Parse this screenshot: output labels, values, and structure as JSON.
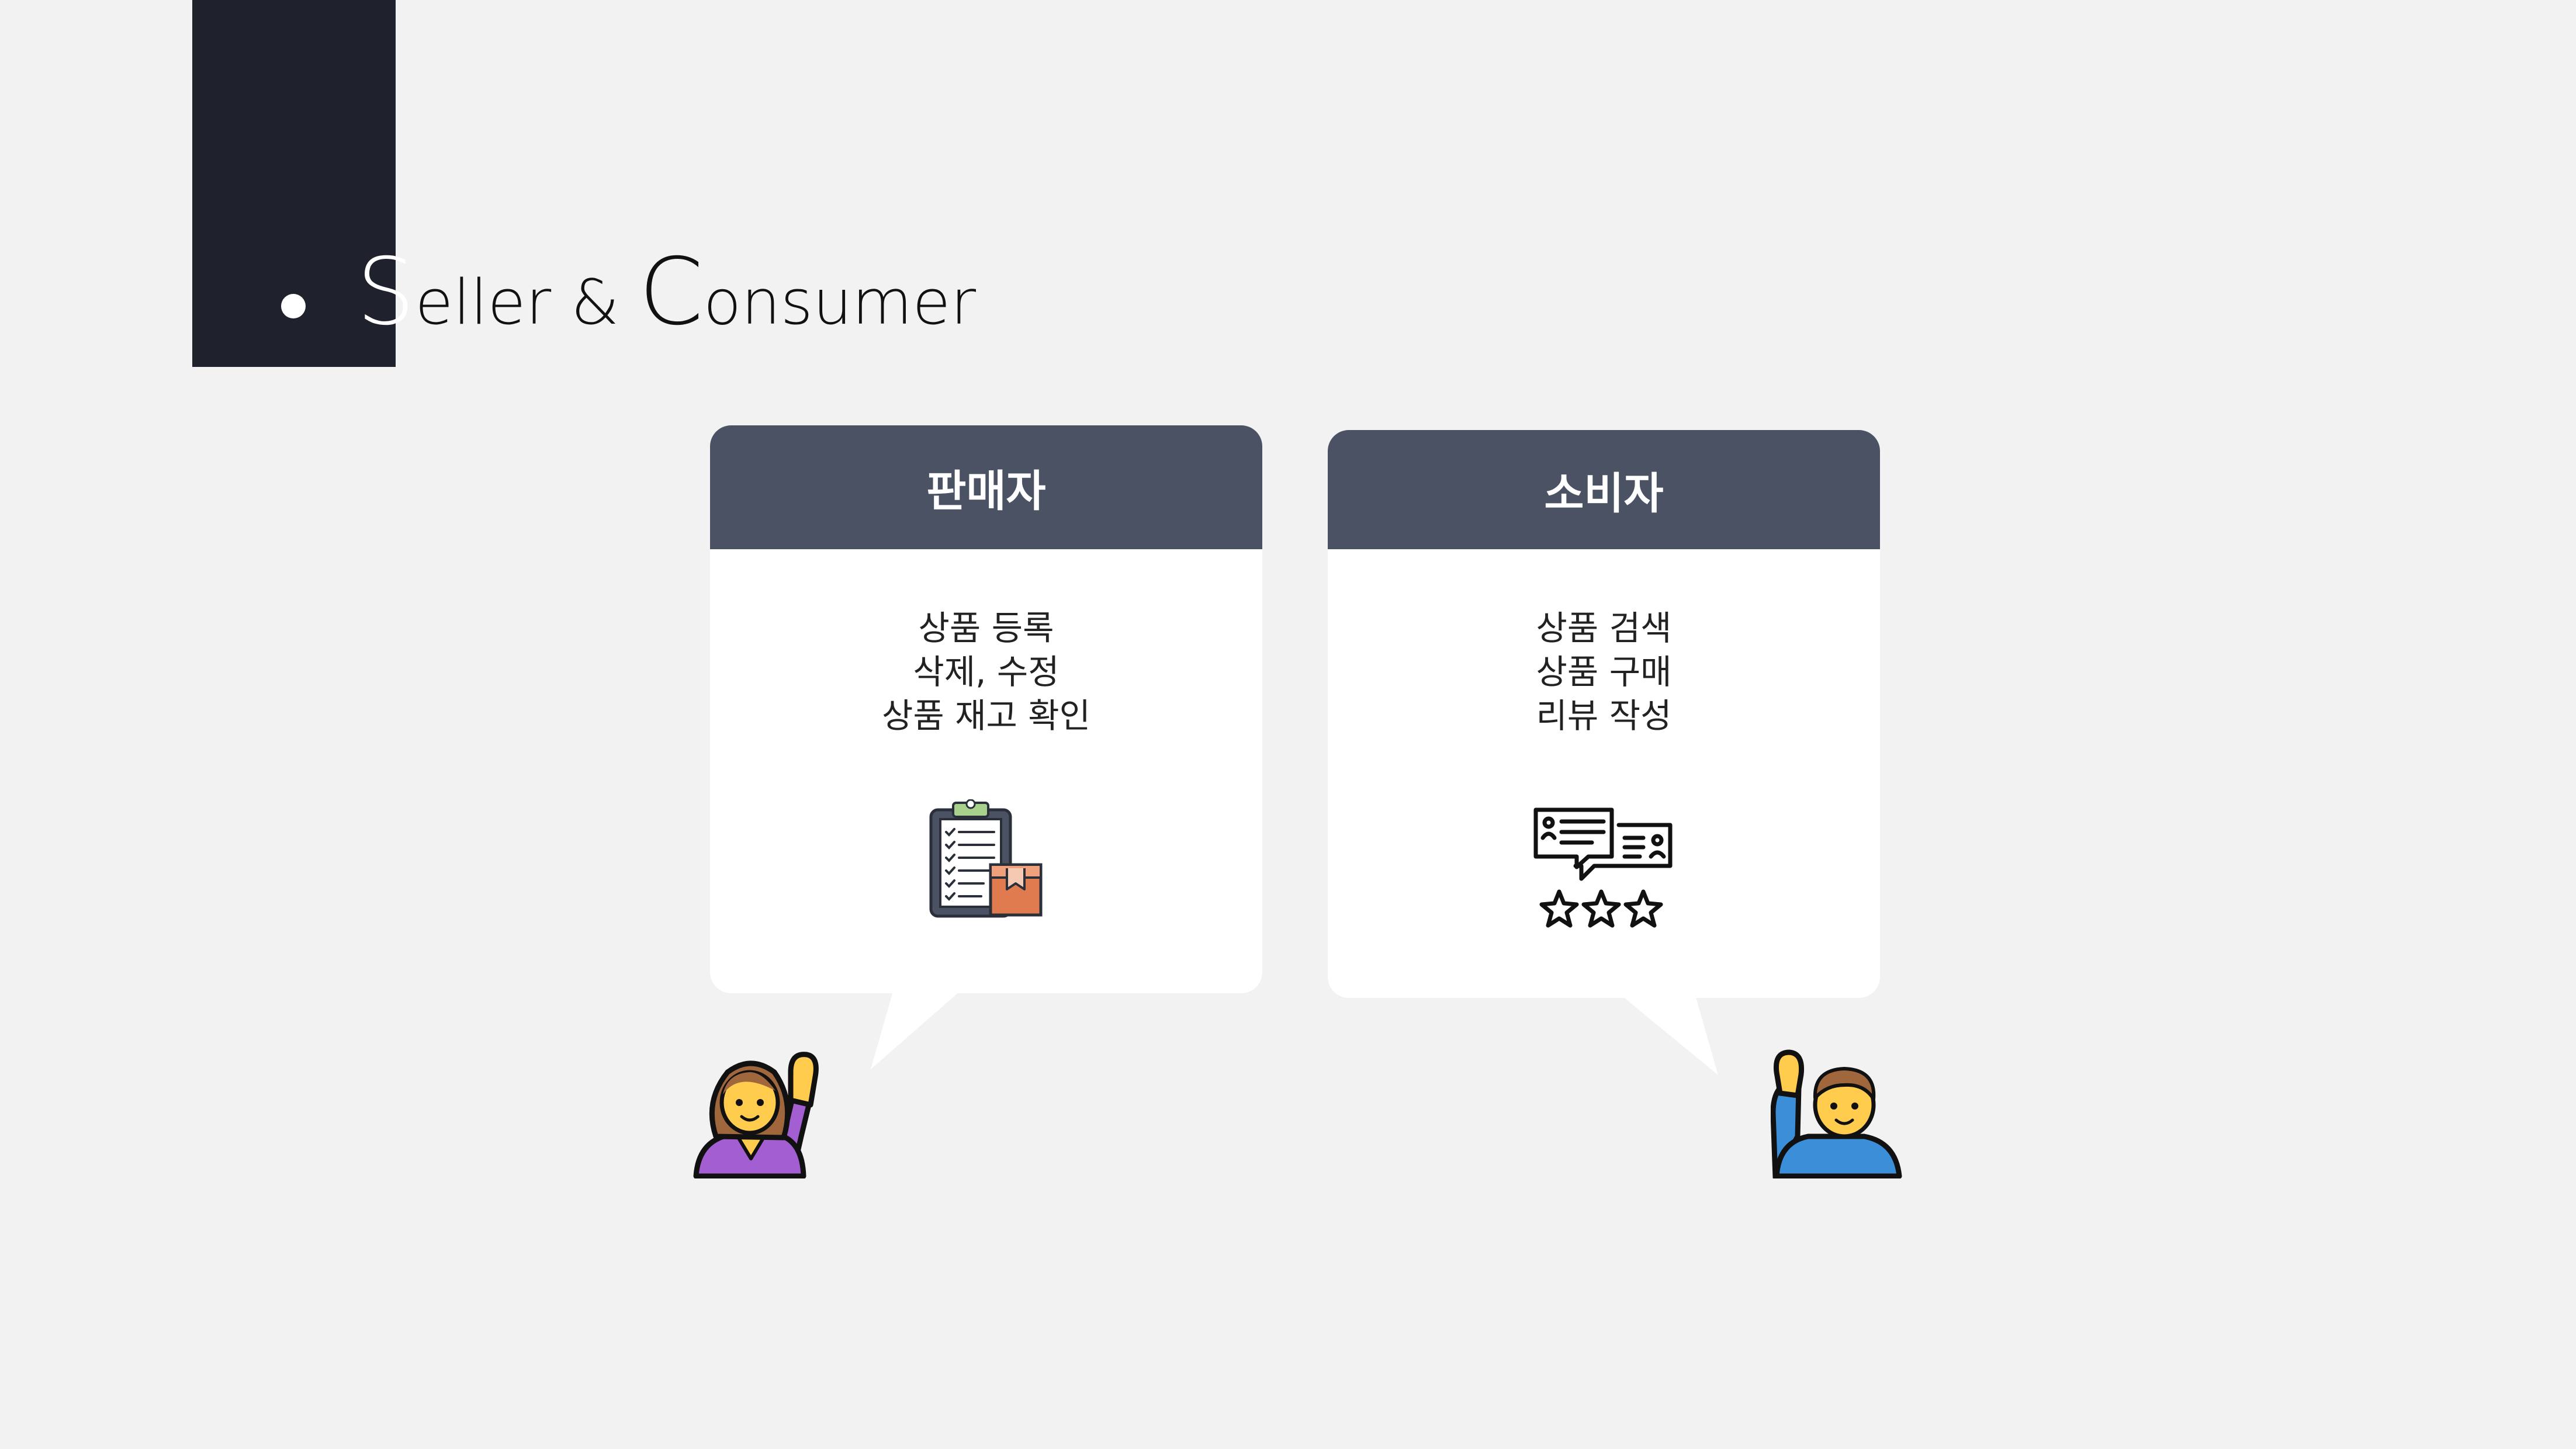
{
  "title": {
    "s": "S",
    "rest1": "eller & ",
    "c": "C",
    "rest2": "onsumer"
  },
  "seller_card": {
    "header": "판매자",
    "lines": [
      "상품 등록",
      "삭제, 수정",
      "상품 재고 확인"
    ],
    "icon": "clipboard-checklist-with-box-icon"
  },
  "consumer_card": {
    "header": "소비자",
    "lines": [
      "상품 검색",
      "상품 구매",
      "리뷰 작성"
    ],
    "icon": "review-chat-with-stars-icon"
  },
  "seller_avatar_icon": "woman-raising-hand-icon",
  "consumer_avatar_icon": "man-raising-hand-icon",
  "colors": {
    "header": "#4a5264",
    "dark_bar": "#1f222d",
    "background": "#f2f2f2"
  }
}
